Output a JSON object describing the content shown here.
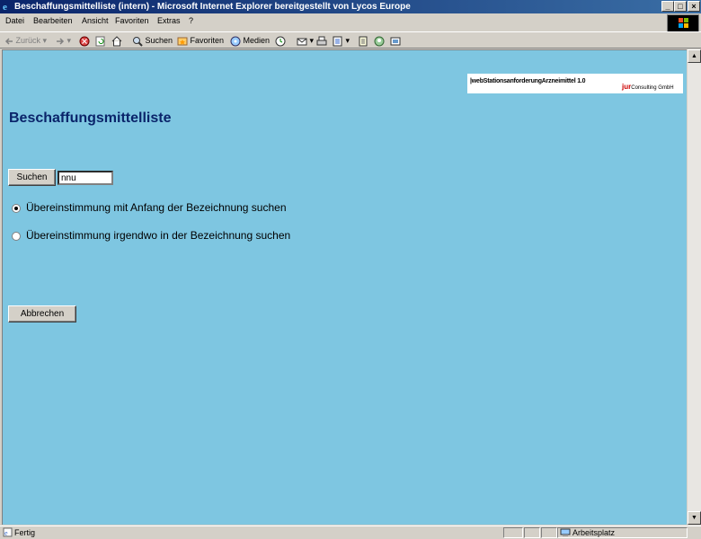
{
  "window": {
    "title": "Beschaffungsmittelliste (intern) - Microsoft Internet Explorer bereitgestellt von Lycos Europe",
    "controls": {
      "minimize": "_",
      "maximize": "□",
      "close": "×"
    }
  },
  "menu": {
    "items": [
      {
        "label": "Datei"
      },
      {
        "label": "Bearbeiten"
      },
      {
        "label": "Ansicht"
      },
      {
        "label": "Favoriten"
      },
      {
        "label": "Extras"
      },
      {
        "label": "?"
      }
    ]
  },
  "toolbar": {
    "back": "Zurück",
    "search": "Suchen",
    "favorites": "Favoriten",
    "media": "Medien"
  },
  "logo": {
    "text": "|webStationsanforderungArzneimittel 1.0",
    "company_mark": "jur",
    "company_name": "Consulting GmbH"
  },
  "page": {
    "title": "Beschaffungsmittelliste",
    "search_button": "Suchen",
    "search_value": "nnu",
    "radio_options": [
      {
        "label": "Übereinstimmung mit Anfang der Bezeichnung suchen",
        "checked": true
      },
      {
        "label": "Übereinstimmung irgendwo in der Bezeichnung suchen",
        "checked": false
      }
    ],
    "cancel_button": "Abbrechen"
  },
  "status": {
    "text": "Fertig",
    "zone": "Arbeitsplatz"
  },
  "colors": {
    "page_background": "#7ec6e1",
    "title_color": "#0a246a",
    "titlebar_start": "#0a246a",
    "titlebar_end": "#3a6ea5"
  }
}
